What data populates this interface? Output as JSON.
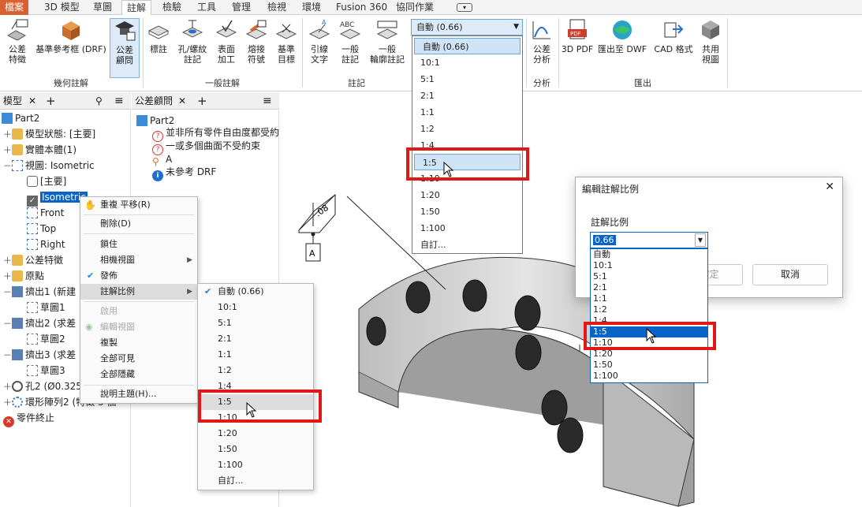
{
  "tabs": [
    "檔案",
    "3D 模型",
    "草圖",
    "註解",
    "檢驗",
    "工具",
    "管理",
    "檢視",
    "環境",
    "Fusion 360",
    "協同作業"
  ],
  "ribbon": {
    "buttons": [
      {
        "label": "公差\n特徵",
        "icon": "tolerance-feature-icon"
      },
      {
        "label": "基準參考框 (DRF)",
        "icon": "datum-reference-frame-icon"
      },
      {
        "label": "公差\n顧問",
        "icon": "tolerance-advisor-icon"
      },
      {
        "label": "標註",
        "icon": "dimension-icon"
      },
      {
        "label": "孔/螺紋\n註記",
        "icon": "hole-thread-note-icon"
      },
      {
        "label": "表面\n加工",
        "icon": "surface-texture-icon"
      },
      {
        "label": "熔接\n符號",
        "icon": "weld-symbol-icon"
      },
      {
        "label": "基準\n目標",
        "icon": "datum-target-icon"
      },
      {
        "label": "引線\n文字",
        "icon": "leader-text-icon"
      },
      {
        "label": "一般\n註記",
        "icon": "general-note-icon"
      },
      {
        "label": "一般\n輪廓註記",
        "icon": "general-profile-note-icon"
      },
      {
        "label": "公差\n分析",
        "icon": "tolerance-analysis-icon"
      },
      {
        "label": "3D PDF",
        "icon": "pdf-icon"
      },
      {
        "label": "匯出至 DWF",
        "icon": "dwf-export-icon"
      },
      {
        "label": "CAD 格式",
        "icon": "cad-format-icon"
      },
      {
        "label": "共用\n視圖",
        "icon": "share-view-icon"
      }
    ],
    "groups": [
      "幾何註解",
      "一般註解",
      "註記",
      "分析",
      "匯出"
    ],
    "scale_select": "自動 (0.66)"
  },
  "model_pane": {
    "tab": "模型",
    "items": [
      "Part2",
      "模型狀態: [主要]",
      "實體本體(1)",
      "視圖: Isometric",
      "[主要]",
      "Isometric",
      "Front",
      "Top",
      "Right",
      "公差特徵",
      "原點",
      "擠出1 (新建",
      "草圖1",
      "擠出2 (求差",
      "草圖2",
      "擠出3 (求差",
      "草圖3",
      "孔2 (Ø0.325",
      "環形陣列2 (特徵 3 個",
      "零件終止"
    ]
  },
  "advisor_pane": {
    "tab": "公差顧問",
    "items": [
      "Part2",
      "並非所有零件自由度都受約",
      "一或多個曲面不受約束",
      "A",
      "未參考 DRF"
    ]
  },
  "context_menu": {
    "items": [
      "重複 平移(R)",
      "刪除(D)",
      "鎖住",
      "相機視圖",
      "發佈",
      "註解比例",
      "啟用",
      "編輯視圖",
      "複製",
      "全部可見",
      "全部隱藏",
      "說明主題(H)..."
    ]
  },
  "scale_options": [
    "自動 (0.66)",
    "10:1",
    "5:1",
    "2:1",
    "1:1",
    "1:2",
    "1:4",
    "1:5",
    "1:10",
    "1:20",
    "1:50",
    "1:100",
    "自訂..."
  ],
  "dialog": {
    "title": "編輯註解比例",
    "label": "註解比例",
    "value": "0.66",
    "list": [
      "自動",
      "10:1",
      "5:1",
      "2:1",
      "1:1",
      "1:2",
      "1:4",
      "1:5",
      "1:10",
      "1:20",
      "1:50",
      "1:100"
    ],
    "ok": "確定",
    "cancel": "取消"
  },
  "canvas": {
    "gdt_value": ".08",
    "datum": "A"
  },
  "colors": {
    "file_tab": "#d8612f",
    "highlight_red": "#e01818",
    "selection_blue": "#0a64c8"
  }
}
